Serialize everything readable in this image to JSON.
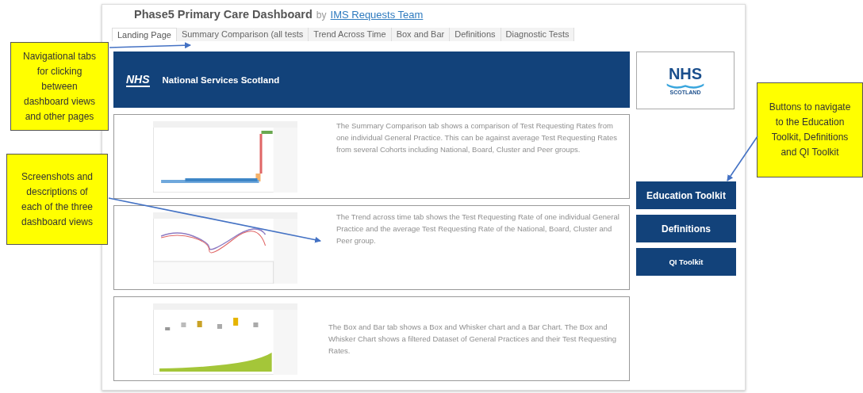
{
  "header": {
    "title": "Phase5 Primary Care Dashboard",
    "by": "by",
    "author_link": "IMS Requests Team"
  },
  "tabs": [
    {
      "label": "Landing Page",
      "selected": true
    },
    {
      "label": "Summary Comparison (all tests",
      "selected": false
    },
    {
      "label": "Trend Across Time",
      "selected": false
    },
    {
      "label": "Box and Bar",
      "selected": false
    },
    {
      "label": "Definitions",
      "selected": false
    },
    {
      "label": "Diagnostic Tests",
      "selected": false
    }
  ],
  "banner": {
    "logo": "NHS",
    "title": "National Services Scotland"
  },
  "logo_box": {
    "logo": "NHS",
    "subtitle": "SCOTLAND"
  },
  "views": [
    {
      "kind": "bars",
      "description": "The Summary Comparison tab shows a comparison of Test Requesting Rates from one individual General Practice. This can be against average Test Requesting Rates from several Cohorts including National, Board, Cluster and Peer groups."
    },
    {
      "kind": "trend",
      "description": "The Trend across time tab shows the Test Requesting Rate of one individual General Practice and the average Test Requesting Rate of the National, Board, Cluster and Peer group."
    },
    {
      "kind": "boxbar",
      "description": "The Box and Bar tab shows a Box and Whisker chart and a Bar Chart. The Box and Whisker Chart shows a filtered Dataset of General Practices and their Test Requesting Rates."
    }
  ],
  "buttons": [
    {
      "label": "Education Toolkit",
      "kind": "large"
    },
    {
      "label": "Definitions",
      "kind": "large"
    },
    {
      "label": "QI Toolkit",
      "kind": "small"
    }
  ],
  "annotations": [
    {
      "text": "Navigational tabs for clicking between dashboard views and other pages"
    },
    {
      "text": "Screenshots and descriptions of each of the three dashboard views"
    },
    {
      "text": "Buttons to navigate to the Education Toolkit, Definitions and QI Toolkit"
    }
  ]
}
